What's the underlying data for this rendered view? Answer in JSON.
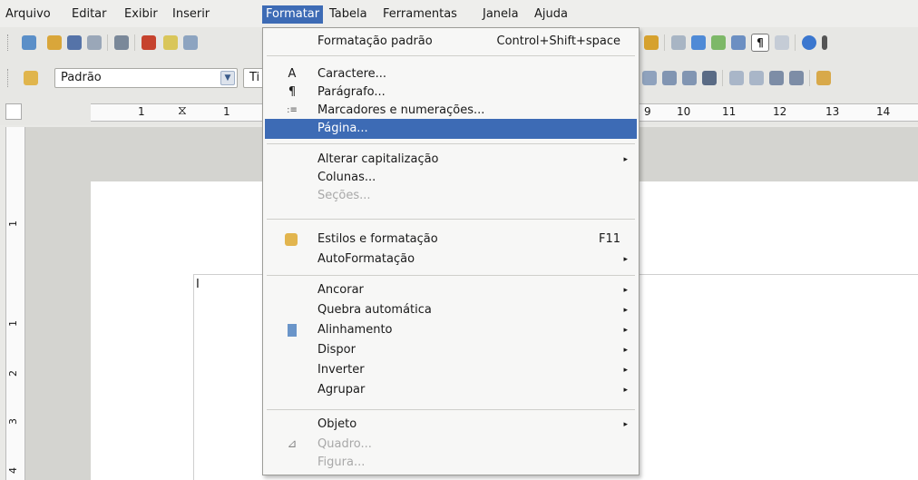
{
  "menubar": {
    "items": [
      "Arquivo",
      "Editar",
      "Exibir",
      "Inserir",
      "Formatar",
      "Tabela",
      "Ferramentas",
      "Janela",
      "Ajuda"
    ],
    "active": "Formatar"
  },
  "toolbar2": {
    "style_combo_value": "Padrão",
    "font_combo_value": "Ti"
  },
  "ruler": {
    "numbers": [
      "1",
      "1",
      "9",
      "10",
      "11",
      "12",
      "13",
      "14"
    ],
    "vertical_numbers": [
      "1",
      "1",
      "2",
      "3",
      "4"
    ]
  },
  "format_menu": {
    "items": [
      {
        "label": "Formatação padrão",
        "shortcut": "Control+Shift+space"
      },
      {
        "label": "Caractere...",
        "icon": "character-icon"
      },
      {
        "label": "Parágrafo...",
        "icon": "paragraph-icon"
      },
      {
        "label": "Marcadores e numerações...",
        "icon": "bullets-icon"
      },
      {
        "label": "Página...",
        "highlighted": true
      },
      {
        "label": "Alterar capitalização",
        "submenu": true
      },
      {
        "label": "Colunas..."
      },
      {
        "label": "Seções...",
        "disabled": true
      },
      {
        "label": "Estilos e formatação",
        "shortcut": "F11",
        "icon": "styles-icon"
      },
      {
        "label": "AutoFormatação",
        "submenu": true
      },
      {
        "label": "Ancorar",
        "submenu": true
      },
      {
        "label": "Quebra automática",
        "submenu": true
      },
      {
        "label": "Alinhamento",
        "submenu": true,
        "icon": "alignment-icon"
      },
      {
        "label": "Dispor",
        "submenu": true
      },
      {
        "label": "Inverter",
        "submenu": true
      },
      {
        "label": "Agrupar",
        "submenu": true
      },
      {
        "label": "Objeto",
        "submenu": true
      },
      {
        "label": "Quadro...",
        "disabled": true,
        "icon": "frame-icon"
      },
      {
        "label": "Figura...",
        "disabled": true
      }
    ]
  },
  "colors": {
    "highlight": "#3d6bb5",
    "menu_bg": "#f7f7f6",
    "disabled_text": "#a8a8a8"
  }
}
